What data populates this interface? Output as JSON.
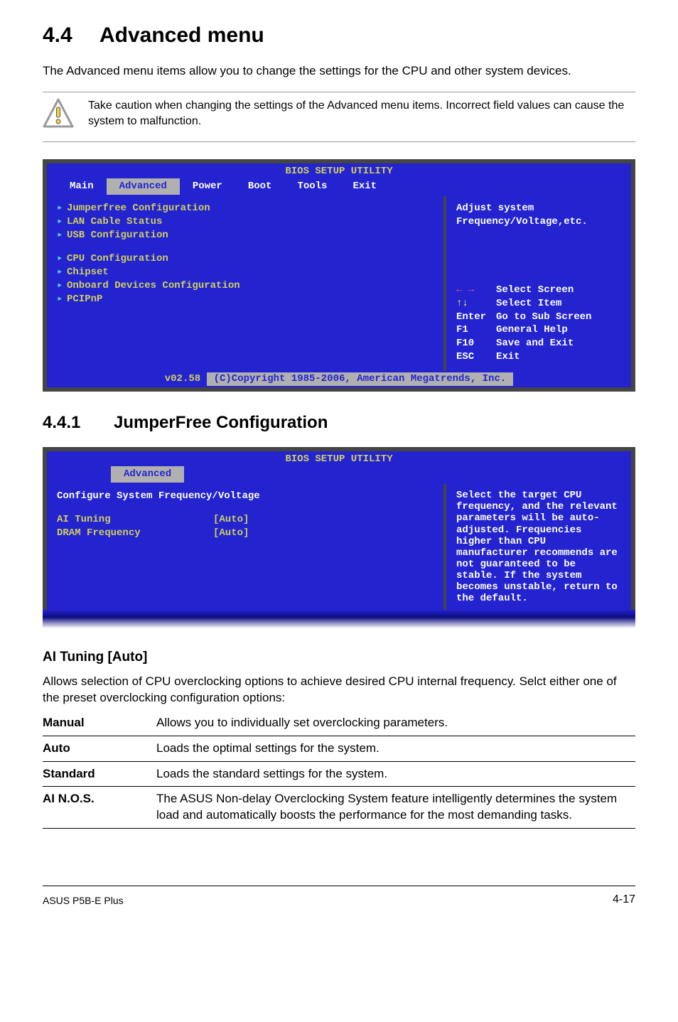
{
  "title_num": "4.4",
  "title_text": "Advanced menu",
  "lead": "The Advanced menu items allow you to change the settings for the CPU and other system devices.",
  "warn": "Take caution when changing the settings of the Advanced menu items. Incorrect field values can cause the system to malfunction.",
  "bios1": {
    "header": "BIOS SETUP UTILITY",
    "tabs": [
      "Main",
      "Advanced",
      "Power",
      "Boot",
      "Tools",
      "Exit"
    ],
    "left_group1": [
      "Jumperfree Configuration",
      "LAN Cable Status",
      "USB Configuration"
    ],
    "left_group2": [
      "CPU Configuration",
      "Chipset",
      "Onboard Devices Configuration",
      "PCIPnP"
    ],
    "right_top_1": "Adjust system",
    "right_top_2": "Frequency/Voltage,etc.",
    "help": {
      "l1": "Select Screen",
      "l2": "Select Item",
      "l3k": "Enter",
      "l3v": "Go to Sub Screen",
      "l4k": "F1",
      "l4v": "General Help",
      "l5k": "F10",
      "l5v": "Save and Exit",
      "l6k": "ESC",
      "l6v": "Exit"
    },
    "footer_ver": "v02.58",
    "footer_copy": "(C)Copyright 1985-2006, American Megatrends, Inc."
  },
  "sub_num": "4.4.1",
  "sub_text": "JumperFree Configuration",
  "bios2": {
    "header": "BIOS SETUP UTILITY",
    "tab": "Advanced",
    "cfg_title": "Configure System Frequency/Voltage",
    "rows": [
      {
        "label": "AI Tuning",
        "value": "[Auto]"
      },
      {
        "label": "DRAM Frequency",
        "value": "[Auto]"
      }
    ],
    "right_text": "Select the target CPU frequency, and the relevant parameters will be auto-adjusted. Frequencies higher than CPU manufacturer recommends are not guaranteed to be stable. If the system becomes unstable, return to the default."
  },
  "opt_heading": "AI Tuning [Auto]",
  "opt_desc": "Allows selection of CPU overclocking options to achieve desired CPU internal frequency. Selct either one of the preset overclocking configuration options:",
  "opts": [
    {
      "k": "Manual",
      "v": "Allows you to individually set overclocking parameters."
    },
    {
      "k": "Auto",
      "v": "Loads the optimal settings for the system."
    },
    {
      "k": "Standard",
      "v": "Loads the standard settings for the system."
    },
    {
      "k": "AI N.O.S.",
      "v": "The ASUS Non-delay Overclocking System feature intelligently determines the system load and automatically boosts the performance for the most demanding tasks."
    }
  ],
  "footer_left": "ASUS P5B-E Plus",
  "footer_right": "4-17"
}
